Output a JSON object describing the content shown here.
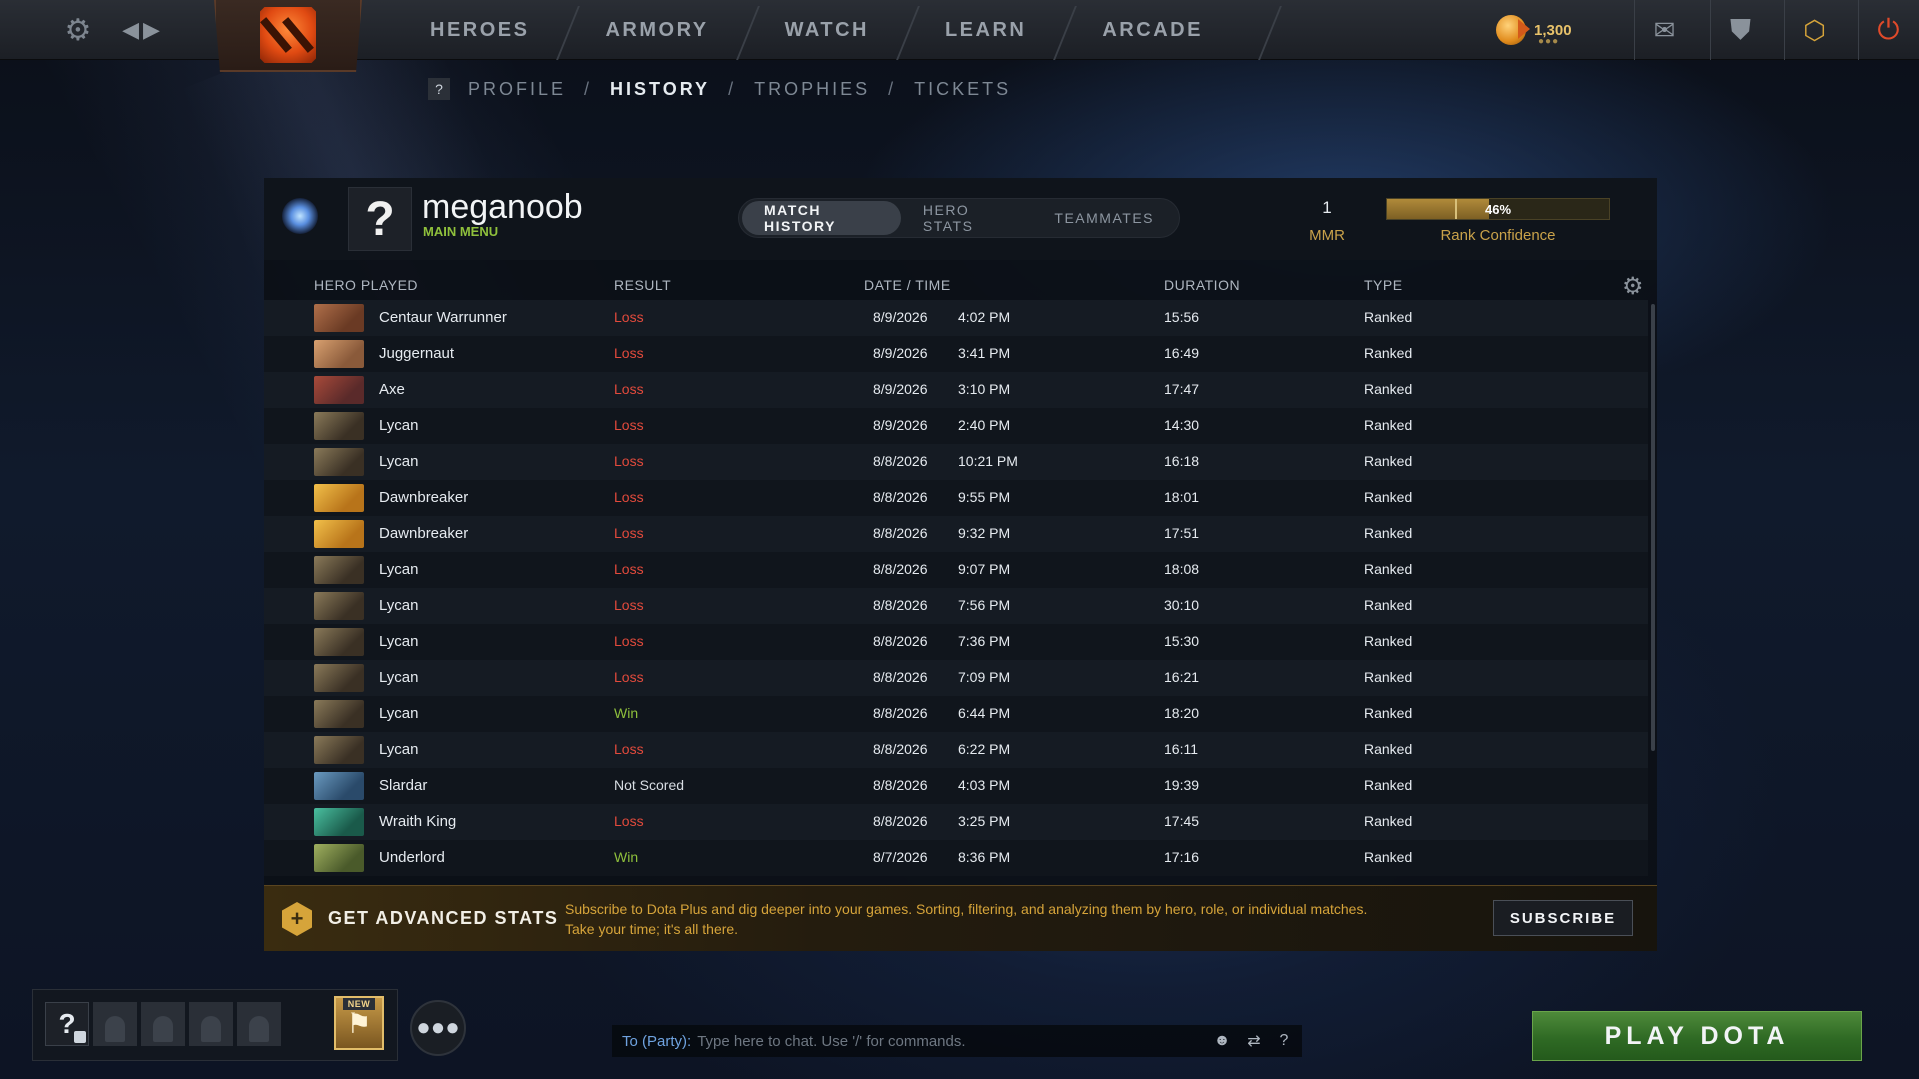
{
  "topbar": {
    "nav": [
      "HEROES",
      "ARMORY",
      "WATCH",
      "LEARN",
      "ARCADE"
    ],
    "shards": "1,300"
  },
  "subnav": {
    "help": "?",
    "items": [
      "PROFILE",
      "HISTORY",
      "TROPHIES",
      "TICKETS"
    ],
    "separator": "/"
  },
  "profile": {
    "avatar_text": "?",
    "username": "meganoob",
    "status": "MAIN MENU",
    "tabs": [
      "MATCH HISTORY",
      "HERO STATS",
      "TEAMMATES"
    ],
    "mmr_value": "1",
    "mmr_label": "MMR",
    "rank_confidence_pct": "46%",
    "rank_confidence_value": 0.46,
    "rank_confidence_label": "Rank Confidence"
  },
  "table": {
    "headers": [
      "HERO PLAYED",
      "RESULT",
      "DATE / TIME",
      "DURATION",
      "TYPE"
    ],
    "rows": [
      {
        "hero": "Centaur Warrunner",
        "result": "Loss",
        "date": "8/9/2026",
        "time": "4:02 PM",
        "duration": "15:56",
        "type": "Ranked"
      },
      {
        "hero": "Juggernaut",
        "result": "Loss",
        "date": "8/9/2026",
        "time": "3:41 PM",
        "duration": "16:49",
        "type": "Ranked"
      },
      {
        "hero": "Axe",
        "result": "Loss",
        "date": "8/9/2026",
        "time": "3:10 PM",
        "duration": "17:47",
        "type": "Ranked"
      },
      {
        "hero": "Lycan",
        "result": "Loss",
        "date": "8/9/2026",
        "time": "2:40 PM",
        "duration": "14:30",
        "type": "Ranked"
      },
      {
        "hero": "Lycan",
        "result": "Loss",
        "date": "8/8/2026",
        "time": "10:21 PM",
        "duration": "16:18",
        "type": "Ranked"
      },
      {
        "hero": "Dawnbreaker",
        "result": "Loss",
        "date": "8/8/2026",
        "time": "9:55 PM",
        "duration": "18:01",
        "type": "Ranked"
      },
      {
        "hero": "Dawnbreaker",
        "result": "Loss",
        "date": "8/8/2026",
        "time": "9:32 PM",
        "duration": "17:51",
        "type": "Ranked"
      },
      {
        "hero": "Lycan",
        "result": "Loss",
        "date": "8/8/2026",
        "time": "9:07 PM",
        "duration": "18:08",
        "type": "Ranked"
      },
      {
        "hero": "Lycan",
        "result": "Loss",
        "date": "8/8/2026",
        "time": "7:56 PM",
        "duration": "30:10",
        "type": "Ranked"
      },
      {
        "hero": "Lycan",
        "result": "Loss",
        "date": "8/8/2026",
        "time": "7:36 PM",
        "duration": "15:30",
        "type": "Ranked"
      },
      {
        "hero": "Lycan",
        "result": "Loss",
        "date": "8/8/2026",
        "time": "7:09 PM",
        "duration": "16:21",
        "type": "Ranked"
      },
      {
        "hero": "Lycan",
        "result": "Win",
        "date": "8/8/2026",
        "time": "6:44 PM",
        "duration": "18:20",
        "type": "Ranked"
      },
      {
        "hero": "Lycan",
        "result": "Loss",
        "date": "8/8/2026",
        "time": "6:22 PM",
        "duration": "16:11",
        "type": "Ranked"
      },
      {
        "hero": "Slardar",
        "result": "Not Scored",
        "date": "8/8/2026",
        "time": "4:03 PM",
        "duration": "19:39",
        "type": "Ranked"
      },
      {
        "hero": "Wraith King",
        "result": "Loss",
        "date": "8/8/2026",
        "time": "3:25 PM",
        "duration": "17:45",
        "type": "Ranked"
      },
      {
        "hero": "Underlord",
        "result": "Win",
        "date": "8/7/2026",
        "time": "8:36 PM",
        "duration": "17:16",
        "type": "Ranked"
      }
    ]
  },
  "hero_colors": {
    "Centaur Warrunner": [
      "#6a3a24",
      "#b0704a"
    ],
    "Juggernaut": [
      "#8a5a3a",
      "#d8a070"
    ],
    "Axe": [
      "#5a2a2a",
      "#a84a3a"
    ],
    "Lycan": [
      "#3a3024",
      "#8a7a5a"
    ],
    "Dawnbreaker": [
      "#b8741a",
      "#f2c04a"
    ],
    "Slardar": [
      "#2a4a6a",
      "#6a9ac0"
    ],
    "Wraith King": [
      "#1a5a4a",
      "#4ac0a0"
    ],
    "Underlord": [
      "#4a5a2a",
      "#a0b060"
    ]
  },
  "promo": {
    "icon": "+",
    "title": "GET ADVANCED STATS",
    "text": "Subscribe to Dota Plus and dig deeper into your games. Sorting, filtering, and analyzing them by hero, role, or individual matches. Take your time; it's all there.",
    "button": "SUBSCRIBE"
  },
  "party": {
    "self": "?",
    "new_badge": "NEW"
  },
  "chat": {
    "label": "To (Party):",
    "placeholder": "Type here to chat. Use '/' for commands.",
    "help": "?"
  },
  "play_button": "PLAY DOTA",
  "colors": {
    "loss": "#e24a3c",
    "win": "#8fc03c",
    "accent_gold": "#c9a24a"
  }
}
